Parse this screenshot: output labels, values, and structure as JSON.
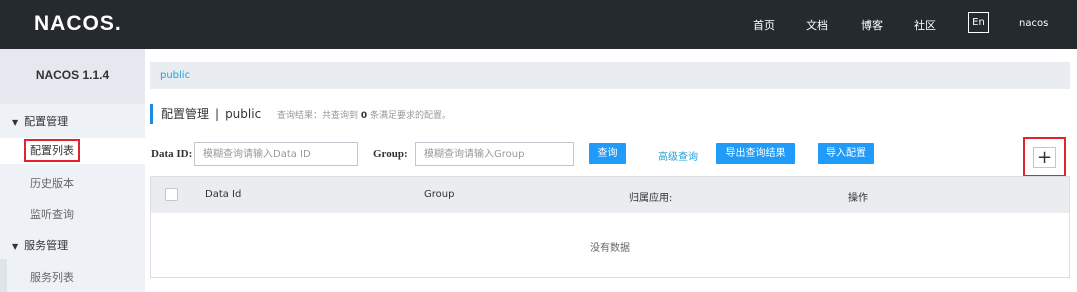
{
  "header": {
    "logo": "NACOS.",
    "nav": [
      "首页",
      "文档",
      "博客",
      "社区"
    ],
    "lang": "En",
    "user": "nacos"
  },
  "sidebar": {
    "version": "NACOS 1.1.4",
    "groups": [
      {
        "label": "配置管理",
        "items": [
          "配置列表",
          "历史版本",
          "监听查询"
        ]
      },
      {
        "label": "服务管理",
        "items": [
          "服务列表"
        ]
      }
    ],
    "active_item": "配置列表"
  },
  "breadcrumb": "public",
  "page": {
    "title": "配置管理",
    "separator": "|",
    "namespace": "public",
    "query_result_prefix": "查询结果：共查询到",
    "query_count": "0",
    "query_result_suffix": "条满足要求的配置。"
  },
  "search": {
    "dataid_label": "Data ID:",
    "dataid_placeholder": "模糊查询请输入Data ID",
    "group_label": "Group:",
    "group_placeholder": "模糊查询请输入Group",
    "query_button": "查询",
    "advanced_link": "高级查询",
    "export_button": "导出查询结果",
    "import_button": "导入配置",
    "add_symbol": "+"
  },
  "table": {
    "columns": [
      "Data Id",
      "Group",
      "归属应用:",
      "操作"
    ],
    "empty_text": "没有数据"
  },
  "colors": {
    "topbar": "#252a2f",
    "primary": "#209bfa",
    "link": "#22a1d9",
    "highlight_box": "#e5212c"
  }
}
